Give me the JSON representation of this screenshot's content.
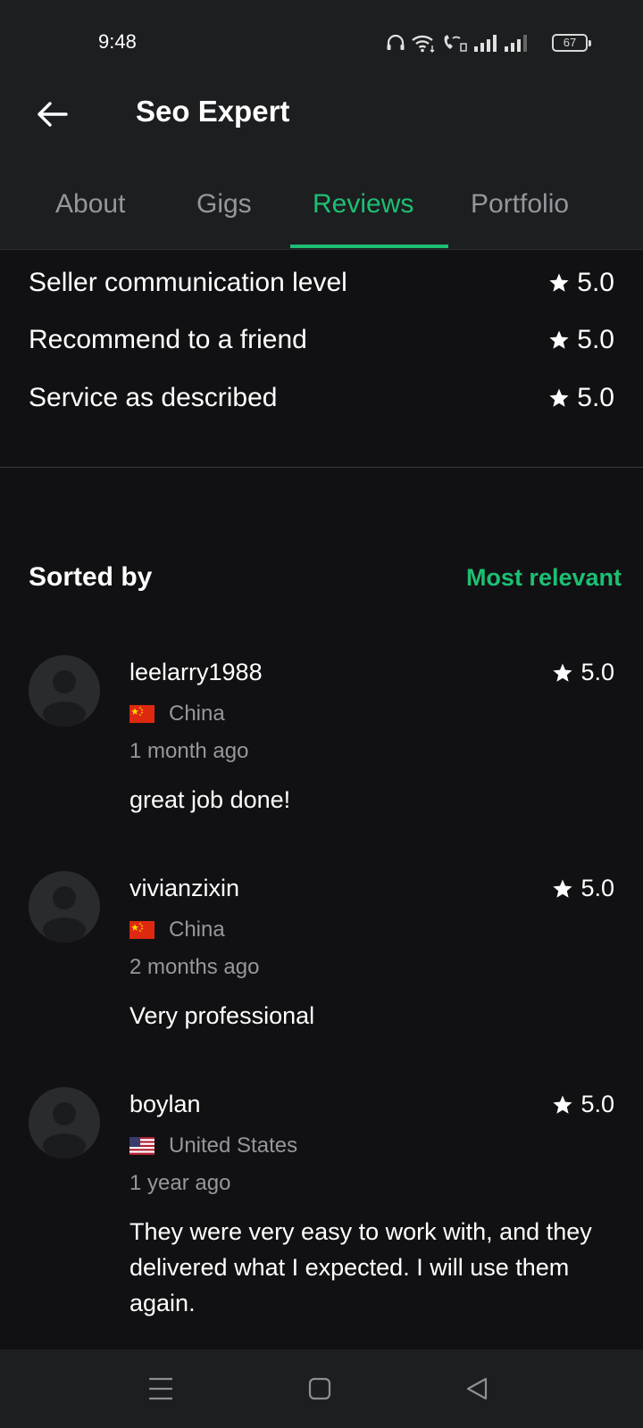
{
  "status_bar": {
    "time": "9:48",
    "battery": "67"
  },
  "header": {
    "title": "Seo Expert"
  },
  "tabs": [
    {
      "label": "About"
    },
    {
      "label": "Gigs"
    },
    {
      "label": "Reviews"
    },
    {
      "label": "Portfolio"
    }
  ],
  "ratings": [
    {
      "label": "Seller communication level",
      "value": "5.0"
    },
    {
      "label": "Recommend to a friend",
      "value": "5.0"
    },
    {
      "label": "Service as described",
      "value": "5.0"
    }
  ],
  "sort": {
    "label": "Sorted by",
    "value": "Most relevant"
  },
  "reviews": [
    {
      "username": "leelarry1988",
      "country": "China",
      "flag": "china-flag-icon",
      "time": "1 month ago",
      "rating": "5.0",
      "text": "great job done!"
    },
    {
      "username": "vivianzixin",
      "country": "China",
      "flag": "china-flag-icon",
      "time": "2 months ago",
      "rating": "5.0",
      "text": "Very professional"
    },
    {
      "username": "boylan",
      "country": "United States",
      "flag": "us-flag-icon",
      "time": "1 year ago",
      "rating": "5.0",
      "text": "They were very easy to work with, and they delivered what I expected. I will use them again."
    }
  ],
  "colors": {
    "accent": "#1dbf73",
    "background": "#111113",
    "header_bg": "#1d1e20",
    "muted_text": "#95979d"
  }
}
